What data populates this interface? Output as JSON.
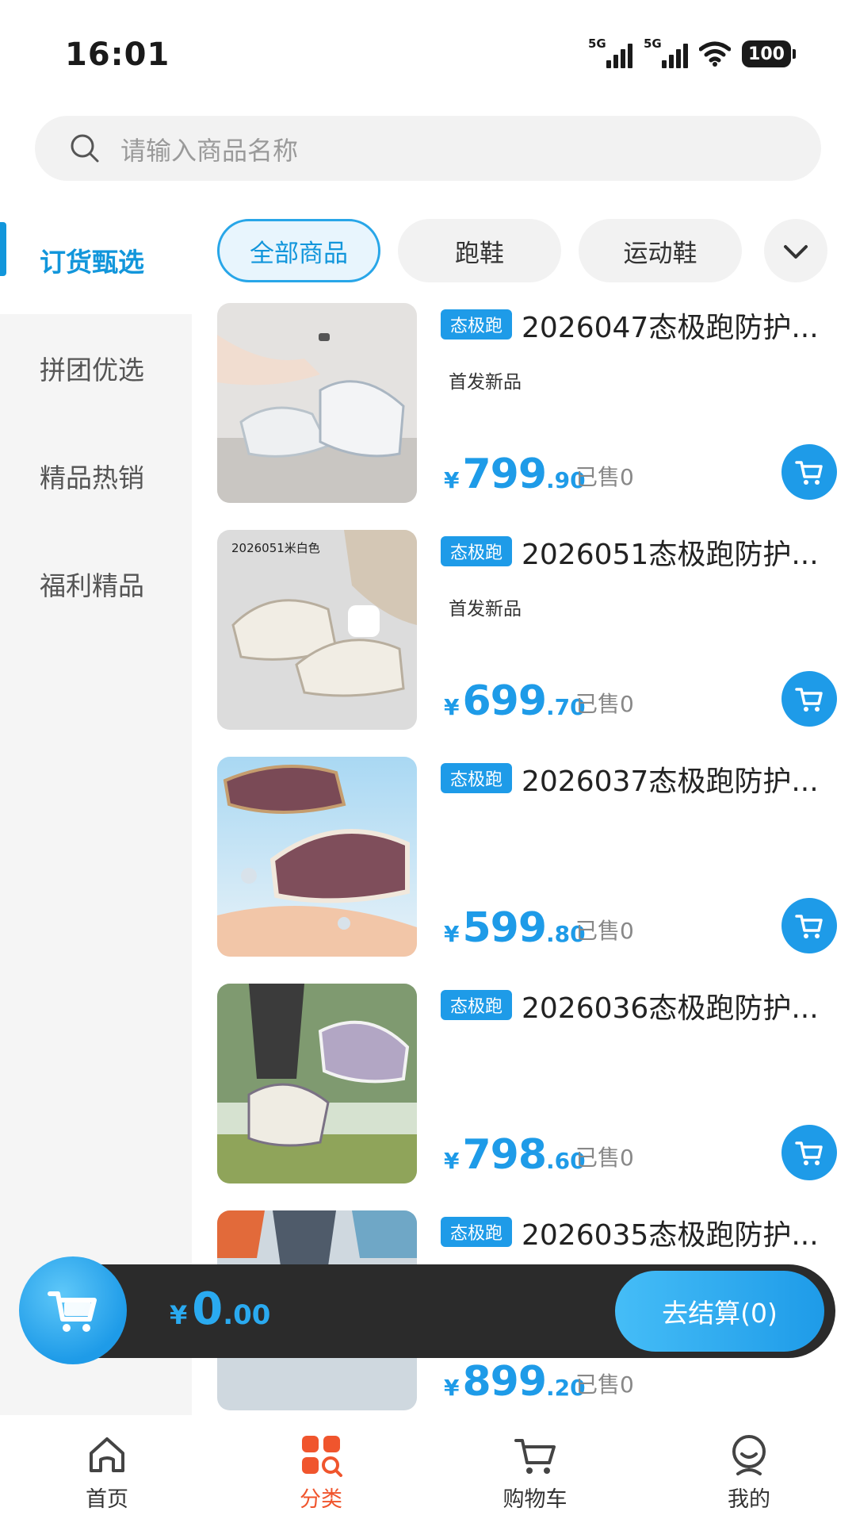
{
  "status_bar": {
    "time": "16:01",
    "sim1": "5G",
    "sim2": "5G",
    "battery": "100"
  },
  "search": {
    "placeholder": "请输入商品名称"
  },
  "sidebar": {
    "items": [
      {
        "label": "订货甄选",
        "active": true
      },
      {
        "label": "拼团优选",
        "active": false
      },
      {
        "label": "精品热销",
        "active": false
      },
      {
        "label": "福利精品",
        "active": false
      }
    ]
  },
  "filters": {
    "chips": [
      {
        "label": "全部商品",
        "active": true
      },
      {
        "label": "跑鞋",
        "active": false
      },
      {
        "label": "运动鞋",
        "active": false
      }
    ]
  },
  "products": [
    {
      "brand": "态极跑",
      "title": "2026047态极跑防护...",
      "tag": "首发新品",
      "price_int": "799",
      "price_dec": ".90",
      "currency": "¥",
      "sold": "已售0"
    },
    {
      "brand": "态极跑",
      "title": "2026051态极跑防护...",
      "tag": "首发新品",
      "image_caption": "2026051米白色",
      "price_int": "699",
      "price_dec": ".70",
      "currency": "¥",
      "sold": "已售0"
    },
    {
      "brand": "态极跑",
      "title": "2026037态极跑防护...",
      "tag": "",
      "price_int": "599",
      "price_dec": ".80",
      "currency": "¥",
      "sold": "已售0"
    },
    {
      "brand": "态极跑",
      "title": "2026036态极跑防护...",
      "tag": "",
      "price_int": "798",
      "price_dec": ".60",
      "currency": "¥",
      "sold": "已售0"
    },
    {
      "brand": "态极跑",
      "title": "2026035态极跑防护...",
      "tag": "",
      "price_int": "899",
      "price_dec": ".20",
      "currency": "¥",
      "sold": "已售0"
    }
  ],
  "checkout": {
    "currency": "¥",
    "total_int": "0",
    "total_dec": ".00",
    "button": "去结算(0)"
  },
  "tabbar": {
    "items": [
      {
        "label": "首页",
        "icon": "home-icon",
        "active": false
      },
      {
        "label": "分类",
        "icon": "category-icon",
        "active": true
      },
      {
        "label": "购物车",
        "icon": "cart-icon",
        "active": false
      },
      {
        "label": "我的",
        "icon": "profile-icon",
        "active": false
      }
    ]
  },
  "colors": {
    "accent": "#1e9be8",
    "active_tab": "#f0552d",
    "checkout_bar": "#2b2b2b"
  }
}
